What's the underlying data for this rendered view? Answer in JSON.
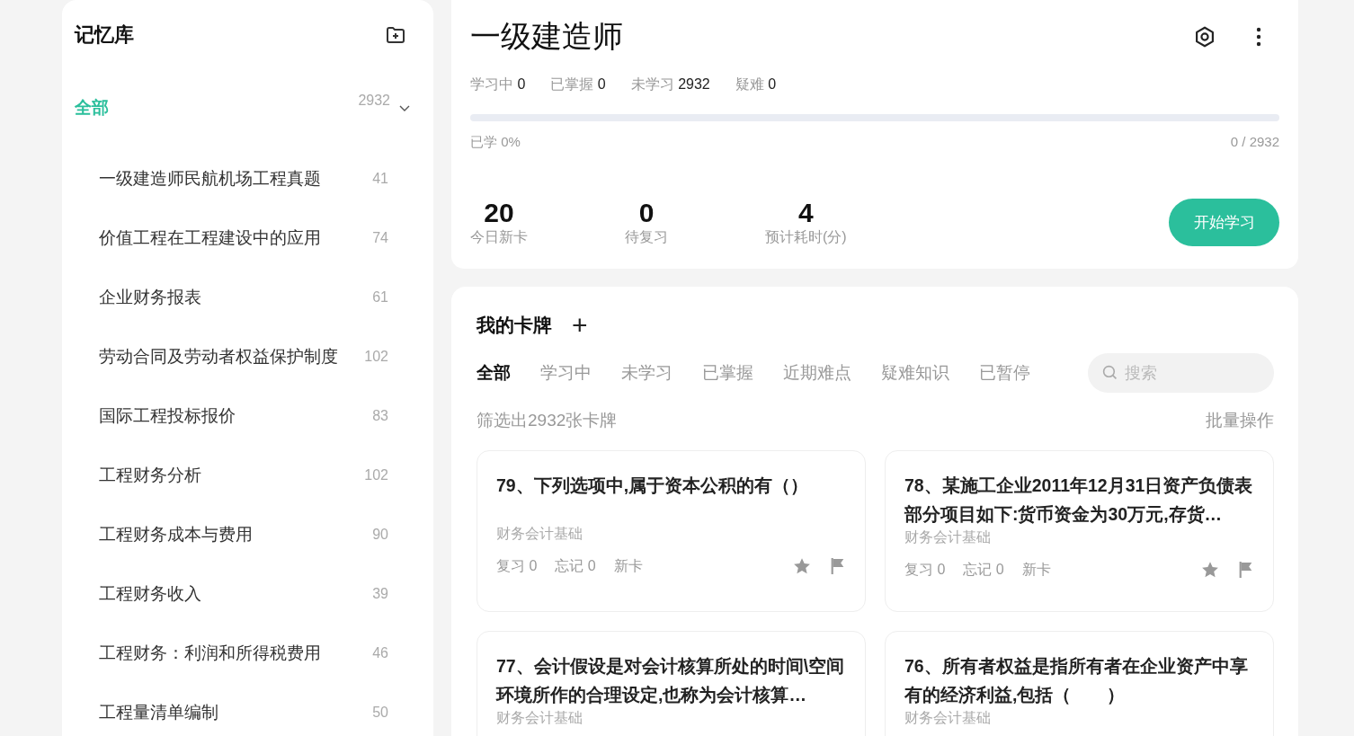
{
  "sidebar": {
    "title": "记忆库",
    "tree": [
      {
        "label": "全部",
        "count": "2932",
        "selected": true,
        "expanded": true,
        "children": [
          {
            "label": "一级建造师民航机场工程真题",
            "count": "41",
            "selected": false
          },
          {
            "label": "价值工程在工程建设中的应用",
            "count": "74",
            "selected": false
          },
          {
            "label": "企业财务报表",
            "count": "61",
            "selected": false
          },
          {
            "label": "劳动合同及劳动者权益保护制度",
            "count": "102",
            "selected": false
          },
          {
            "label": "国际工程投标报价",
            "count": "83",
            "selected": false
          },
          {
            "label": "工程财务分析",
            "count": "102",
            "selected": false
          },
          {
            "label": "工程财务成本与费用",
            "count": "90",
            "selected": false
          },
          {
            "label": "工程财务收入",
            "count": "39",
            "selected": false
          },
          {
            "label": "工程财务：利润和所得税费用",
            "count": "46",
            "selected": false
          },
          {
            "label": "工程量清单编制",
            "count": "50",
            "selected": false
          }
        ]
      }
    ]
  },
  "deck": {
    "title": "一级建造师",
    "stats": [
      {
        "label": "学习中",
        "value": "0"
      },
      {
        "label": "已掌握",
        "value": "0"
      },
      {
        "label": "未学习",
        "value": "2932"
      },
      {
        "label": "疑难",
        "value": "0"
      }
    ],
    "progress": {
      "level": 0,
      "label": "已学 0%",
      "count": "0 / 2932"
    },
    "summary": [
      {
        "value": "20",
        "label": "今日新卡"
      },
      {
        "value": "0",
        "label": "待复习"
      },
      {
        "value": "4",
        "label": "预计耗时(分)"
      }
    ],
    "start_button": "开始学习"
  },
  "cards": {
    "title": "我的卡牌",
    "add": "+",
    "tabs": [
      {
        "label": "全部",
        "selected": true
      },
      {
        "label": "学习中",
        "selected": false
      },
      {
        "label": "未学习",
        "selected": false
      },
      {
        "label": "已掌握",
        "selected": false
      },
      {
        "label": "近期难点",
        "selected": false
      },
      {
        "label": "疑难知识",
        "selected": false
      },
      {
        "label": "已暂停",
        "selected": false
      }
    ],
    "search": {
      "placeholder": "搜索"
    },
    "filter_text": "筛选出2932张卡牌",
    "batch": "批量操作",
    "items": [
      {
        "title": "79、下列选项中,属于资本公积的有（）",
        "category": "财务会计基础",
        "review": "复习 0",
        "forget": "忘记 0",
        "status": "新卡"
      },
      {
        "title": "78、某施工企业2011年12月31日资产负债表部分项目如下:货币资金为30万元,存货…",
        "category": "财务会计基础",
        "review": "复习 0",
        "forget": "忘记 0",
        "status": "新卡"
      },
      {
        "title": "77、会计假设是对会计核算所处的时间\\空间环境所作的合理设定,也称为会计核算…",
        "category": "财务会计基础"
      },
      {
        "title": "76、所有者权益是指所有者在企业资产中享有的经济利益,包括（　　）",
        "category": "财务会计基础"
      }
    ]
  }
}
